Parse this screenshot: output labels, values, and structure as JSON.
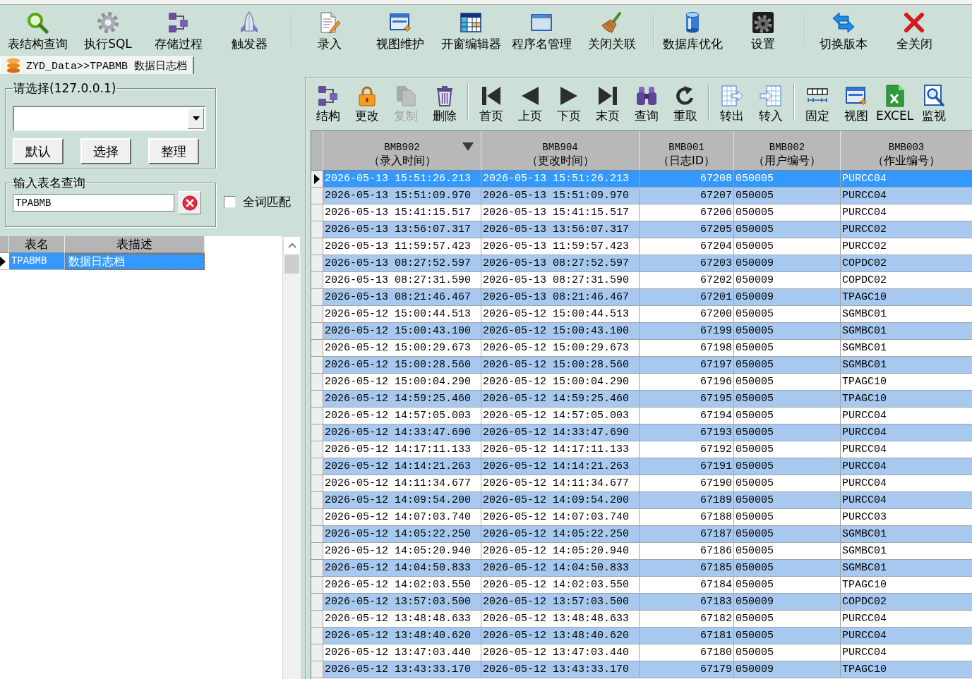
{
  "toolbar": {
    "groups": [
      {
        "buttons": [
          {
            "label": "表结构查询"
          },
          {
            "label": "执行SQL"
          },
          {
            "label": "存储过程"
          },
          {
            "label": "触发器"
          }
        ]
      },
      {
        "buttons": [
          {
            "label": "录入"
          },
          {
            "label": "视图维护"
          },
          {
            "label": "开窗编辑器"
          },
          {
            "label": "程序名管理"
          },
          {
            "label": "关闭关联"
          }
        ]
      },
      {
        "buttons": [
          {
            "label": "数据库优化"
          },
          {
            "label": "设置"
          }
        ]
      },
      {
        "buttons": [
          {
            "label": "切换版本"
          },
          {
            "label": "全关闭"
          }
        ]
      }
    ]
  },
  "tabs": [
    {
      "label": "ZYD_Data>>TPABMB 数据日志档",
      "selected": true
    }
  ],
  "server_group": {
    "title": "请选择(127.0.0.1)",
    "buttons": [
      "默认",
      "选择",
      "整理"
    ]
  },
  "table_search": {
    "title": "输入表名查询",
    "value": "TPABMB",
    "whole_word": {
      "label": "全词匹配",
      "checked": false
    }
  },
  "table_list": {
    "columns": [
      "表名",
      "表描述"
    ],
    "rows": [
      {
        "cells": [
          "TPABMB",
          "数据日志档"
        ],
        "selected": true
      }
    ]
  },
  "grid_toolbar": {
    "groups": [
      {
        "buttons": [
          {
            "label": "结构",
            "disabled": false
          },
          {
            "label": "更改",
            "disabled": false
          },
          {
            "label": "复制",
            "disabled": true
          },
          {
            "label": "删除",
            "disabled": false
          }
        ]
      },
      {
        "buttons": [
          {
            "label": "首页",
            "disabled": false
          },
          {
            "label": "上页",
            "disabled": false
          },
          {
            "label": "下页",
            "disabled": false
          },
          {
            "label": "末页",
            "disabled": false
          },
          {
            "label": "查询",
            "disabled": false
          },
          {
            "label": "重取",
            "disabled": false
          }
        ]
      },
      {
        "buttons": [
          {
            "label": "转出",
            "disabled": false
          },
          {
            "label": "转入",
            "disabled": false
          }
        ]
      },
      {
        "buttons": [
          {
            "label": "固定",
            "disabled": false
          },
          {
            "label": "视图",
            "disabled": false
          },
          {
            "label": "EXCEL",
            "disabled": false
          },
          {
            "label": "监视",
            "disabled": false
          }
        ]
      }
    ]
  },
  "data_grid": {
    "columns": [
      {
        "code": "BMB902",
        "caption": "（录入时间）",
        "sorted": true
      },
      {
        "code": "BMB904",
        "caption": "（更改时间）",
        "sorted": false
      },
      {
        "code": "BMB001",
        "caption": "（日志ID）",
        "sorted": false
      },
      {
        "code": "BMB002",
        "caption": "（用户编号）",
        "sorted": false
      },
      {
        "code": "BMB003",
        "caption": "（作业编号）",
        "sorted": false
      }
    ],
    "rows": [
      {
        "cells": [
          "2026-05-13 15:51:26.213",
          "2026-05-13 15:51:26.213",
          "67208",
          "050005",
          "PURCC04"
        ],
        "selected": true
      },
      {
        "cells": [
          "2026-05-13 15:51:09.970",
          "2026-05-13 15:51:09.970",
          "67207",
          "050005",
          "PURCC04"
        ],
        "selected": false
      },
      {
        "cells": [
          "2026-05-13 15:41:15.517",
          "2026-05-13 15:41:15.517",
          "67206",
          "050005",
          "PURCC04"
        ],
        "selected": false
      },
      {
        "cells": [
          "2026-05-13 13:56:07.317",
          "2026-05-13 13:56:07.317",
          "67205",
          "050005",
          "PURCC02"
        ],
        "selected": false
      },
      {
        "cells": [
          "2026-05-13 11:59:57.423",
          "2026-05-13 11:59:57.423",
          "67204",
          "050005",
          "PURCC02"
        ],
        "selected": false
      },
      {
        "cells": [
          "2026-05-13 08:27:52.597",
          "2026-05-13 08:27:52.597",
          "67203",
          "050009",
          "COPDC02"
        ],
        "selected": false
      },
      {
        "cells": [
          "2026-05-13 08:27:31.590",
          "2026-05-13 08:27:31.590",
          "67202",
          "050009",
          "COPDC02"
        ],
        "selected": false
      },
      {
        "cells": [
          "2026-05-13 08:21:46.467",
          "2026-05-13 08:21:46.467",
          "67201",
          "050009",
          "TPAGC10"
        ],
        "selected": false
      },
      {
        "cells": [
          "2026-05-12 15:00:44.513",
          "2026-05-12 15:00:44.513",
          "67200",
          "050005",
          "SGMBC01"
        ],
        "selected": false
      },
      {
        "cells": [
          "2026-05-12 15:00:43.100",
          "2026-05-12 15:00:43.100",
          "67199",
          "050005",
          "SGMBC01"
        ],
        "selected": false
      },
      {
        "cells": [
          "2026-05-12 15:00:29.673",
          "2026-05-12 15:00:29.673",
          "67198",
          "050005",
          "SGMBC01"
        ],
        "selected": false
      },
      {
        "cells": [
          "2026-05-12 15:00:28.560",
          "2026-05-12 15:00:28.560",
          "67197",
          "050005",
          "SGMBC01"
        ],
        "selected": false
      },
      {
        "cells": [
          "2026-05-12 15:00:04.290",
          "2026-05-12 15:00:04.290",
          "67196",
          "050005",
          "TPAGC10"
        ],
        "selected": false
      },
      {
        "cells": [
          "2026-05-12 14:59:25.460",
          "2026-05-12 14:59:25.460",
          "67195",
          "050005",
          "TPAGC10"
        ],
        "selected": false
      },
      {
        "cells": [
          "2026-05-12 14:57:05.003",
          "2026-05-12 14:57:05.003",
          "67194",
          "050005",
          "PURCC04"
        ],
        "selected": false
      },
      {
        "cells": [
          "2026-05-12 14:33:47.690",
          "2026-05-12 14:33:47.690",
          "67193",
          "050005",
          "PURCC04"
        ],
        "selected": false
      },
      {
        "cells": [
          "2026-05-12 14:17:11.133",
          "2026-05-12 14:17:11.133",
          "67192",
          "050005",
          "PURCC04"
        ],
        "selected": false
      },
      {
        "cells": [
          "2026-05-12 14:14:21.263",
          "2026-05-12 14:14:21.263",
          "67191",
          "050005",
          "PURCC04"
        ],
        "selected": false
      },
      {
        "cells": [
          "2026-05-12 14:11:34.677",
          "2026-05-12 14:11:34.677",
          "67190",
          "050005",
          "PURCC04"
        ],
        "selected": false
      },
      {
        "cells": [
          "2026-05-12 14:09:54.200",
          "2026-05-12 14:09:54.200",
          "67189",
          "050005",
          "PURCC04"
        ],
        "selected": false
      },
      {
        "cells": [
          "2026-05-12 14:07:03.740",
          "2026-05-12 14:07:03.740",
          "67188",
          "050005",
          "PURCC03"
        ],
        "selected": false
      },
      {
        "cells": [
          "2026-05-12 14:05:22.250",
          "2026-05-12 14:05:22.250",
          "67187",
          "050005",
          "SGMBC01"
        ],
        "selected": false
      },
      {
        "cells": [
          "2026-05-12 14:05:20.940",
          "2026-05-12 14:05:20.940",
          "67186",
          "050005",
          "SGMBC01"
        ],
        "selected": false
      },
      {
        "cells": [
          "2026-05-12 14:04:50.833",
          "2026-05-12 14:04:50.833",
          "67185",
          "050005",
          "SGMBC01"
        ],
        "selected": false
      },
      {
        "cells": [
          "2026-05-12 14:02:03.550",
          "2026-05-12 14:02:03.550",
          "67184",
          "050005",
          "TPAGC10"
        ],
        "selected": false
      },
      {
        "cells": [
          "2026-05-12 13:57:03.500",
          "2026-05-12 13:57:03.500",
          "67183",
          "050009",
          "COPDC02"
        ],
        "selected": false
      },
      {
        "cells": [
          "2026-05-12 13:48:48.633",
          "2026-05-12 13:48:48.633",
          "67182",
          "050005",
          "PURCC04"
        ],
        "selected": false
      },
      {
        "cells": [
          "2026-05-12 13:48:40.620",
          "2026-05-12 13:48:40.620",
          "67181",
          "050005",
          "PURCC04"
        ],
        "selected": false
      },
      {
        "cells": [
          "2026-05-12 13:47:03.440",
          "2026-05-12 13:47:03.440",
          "67180",
          "050005",
          "PURCC04"
        ],
        "selected": false
      },
      {
        "cells": [
          "2026-05-12 13:43:33.170",
          "2026-05-12 13:43:33.170",
          "67179",
          "050009",
          "TPAGC10"
        ],
        "selected": false
      }
    ]
  }
}
